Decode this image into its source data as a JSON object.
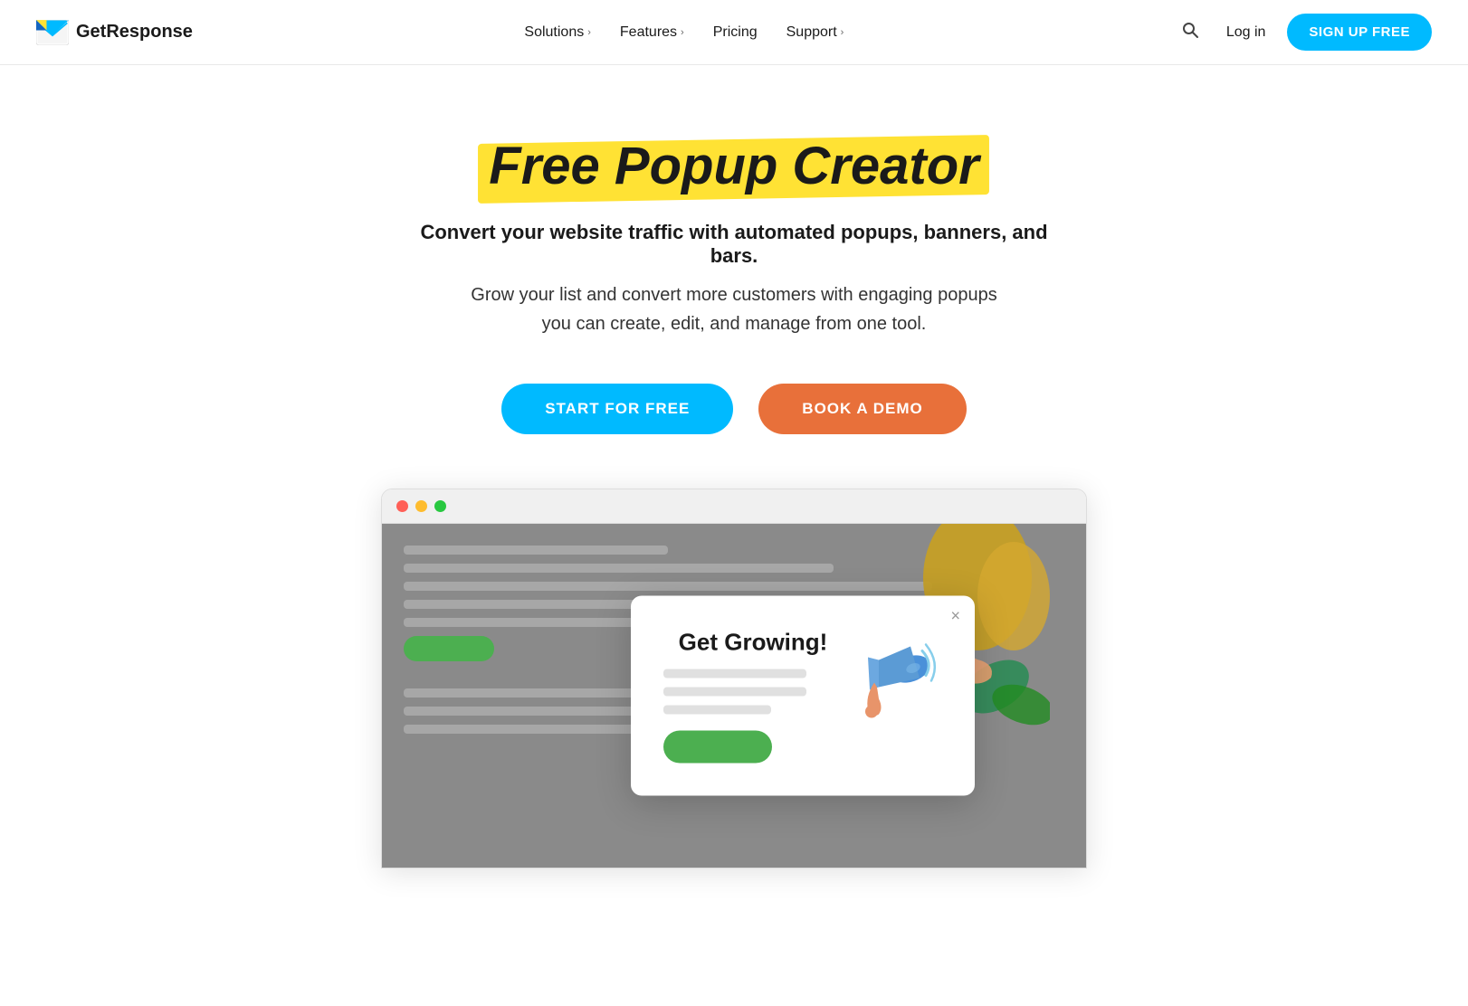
{
  "brand": {
    "name": "GetResponse",
    "logo_alt": "GetResponse logo"
  },
  "nav": {
    "solutions_label": "Solutions",
    "features_label": "Features",
    "pricing_label": "Pricing",
    "support_label": "Support",
    "login_label": "Log in",
    "signup_label": "SIGN UP FREE"
  },
  "hero": {
    "title": "Free Popup Creator",
    "subtitle_bold": "Convert your website traffic with automated popups, banners, and bars.",
    "subtitle": "Grow your list and convert more customers with engaging popups you can create, edit, and manage from one tool.",
    "btn_start": "START FOR FREE",
    "btn_demo": "BOOK A DEMO"
  },
  "popup_demo": {
    "title": "Get Growing!",
    "close": "×"
  },
  "browser_dots": {
    "red": "red dot",
    "yellow": "yellow dot",
    "green": "green dot"
  }
}
